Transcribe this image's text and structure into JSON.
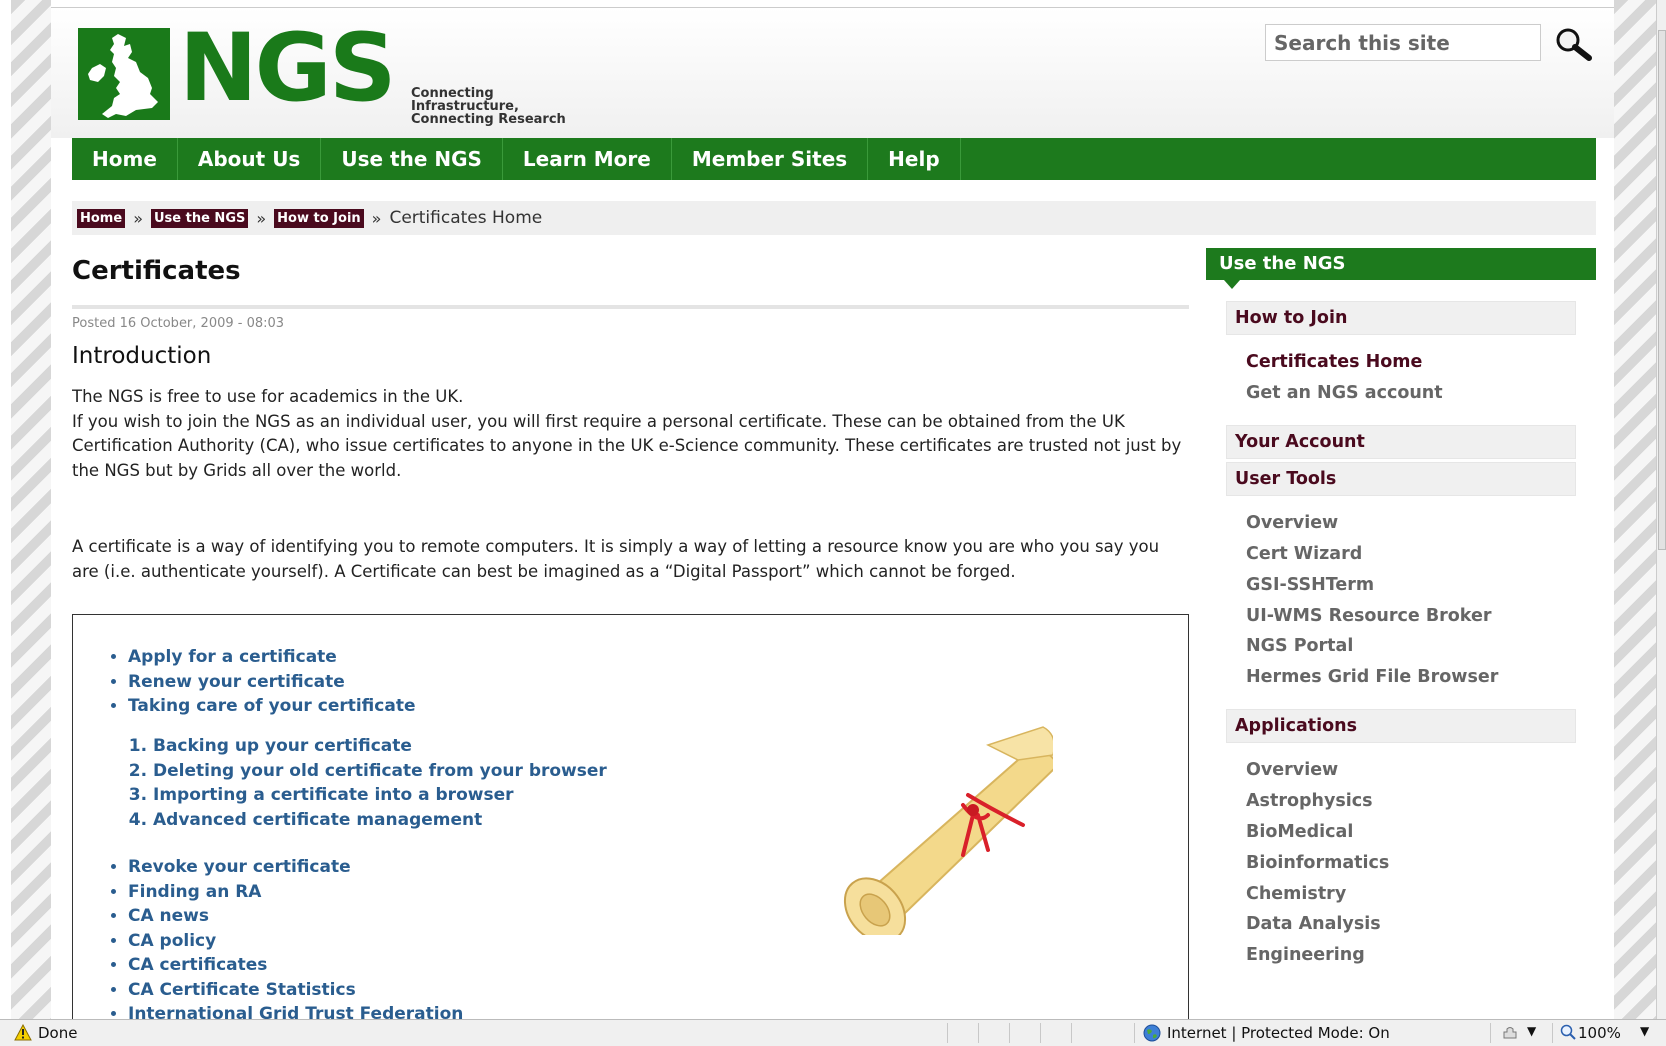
{
  "site": {
    "logo_text": "NGS",
    "tagline": [
      "Connecting",
      "Infrastructure,",
      "Connecting Research"
    ],
    "brand_color": "#1d7a1d"
  },
  "search": {
    "placeholder": "Search this site"
  },
  "nav": [
    "Home",
    "About Us",
    "Use the NGS",
    "Learn More",
    "Member Sites",
    "Help"
  ],
  "breadcrumb": {
    "links": [
      "Home",
      "Use the NGS",
      "How to Join"
    ],
    "separator": "»",
    "current": "Certificates Home"
  },
  "main": {
    "title": "Certificates",
    "posted": "Posted 16 October, 2009 - 08:03",
    "intro_heading": "Introduction",
    "para1_line1": "The NGS is free to use for academics in the UK.",
    "para1_line2": "If you wish to join the NGS as an individual user, you will first require a personal certificate. These can be obtained from the UK Certification Authority (CA), who issue certificates to anyone in the UK e-Science community. These certificates are trusted not just by the NGS but by Grids all over the world.",
    "para2": "A certificate is a way of identifying you to remote computers. It is simply a way of letting a resource know you are who you say you are (i.e. authenticate yourself). A Certificate can best be imagined as a “Digital Passport” which cannot be forged.",
    "links_a": [
      "Apply for a certificate",
      "Renew your certificate",
      "Taking care of your certificate"
    ],
    "links_b": [
      "Backing up your certificate",
      "Deleting your old certificate from your browser",
      "Importing a certificate into a browser",
      "Advanced certificate management"
    ],
    "links_c": [
      "Revoke your certificate",
      "Finding an RA",
      "CA news",
      "CA policy",
      "CA certificates",
      "CA Certificate Statistics",
      "International Grid Trust Federation"
    ],
    "image_icon": "certificate-scroll"
  },
  "sidebar": {
    "header": "Use the NGS",
    "sections": {
      "how_to_join": "How to Join",
      "your_account": "Your Account",
      "user_tools": "User Tools",
      "applications": "Applications"
    },
    "how_to_join_items": [
      "Certificates Home",
      "Get an NGS account"
    ],
    "user_tools_items": [
      "Overview",
      "Cert Wizard",
      "GSI-SSHTerm",
      "UI-WMS Resource Broker",
      "NGS Portal",
      "Hermes Grid File Browser"
    ],
    "applications_items": [
      "Overview",
      "Astrophysics",
      "BioMedical",
      "Bioinformatics",
      "Chemistry",
      "Data Analysis",
      "Engineering"
    ]
  },
  "status_bar": {
    "status": "Done",
    "zone": "Internet | Protected Mode: On",
    "zoom": "100%"
  }
}
